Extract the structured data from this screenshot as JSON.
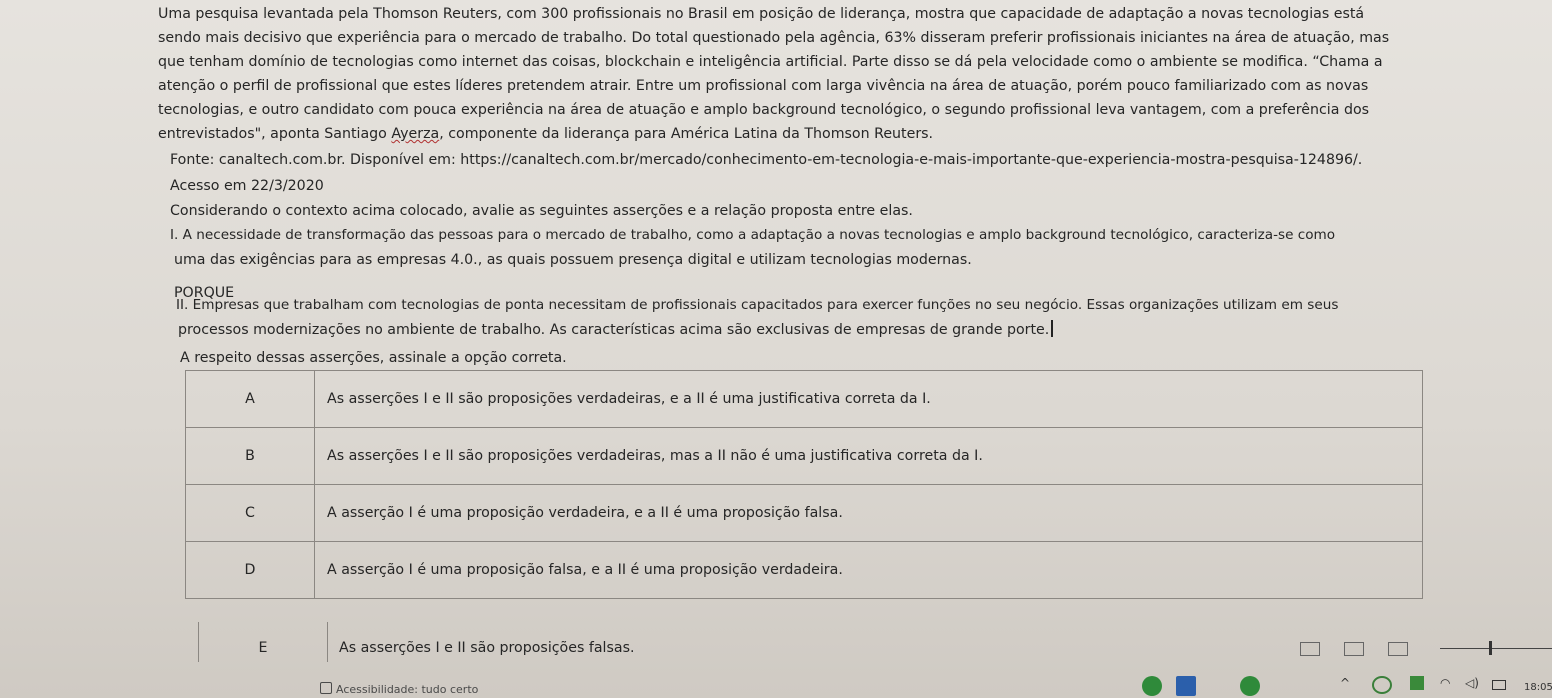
{
  "paragraph": {
    "lines": [
      "Uma pesquisa levantada pela Thomson Reuters, com 300 profissionais no Brasil em posição de liderança, mostra que capacidade de adaptação a novas tecnologias está",
      "sendo mais decisivo que experiência para o mercado de trabalho. Do total questionado pela agência, 63% disseram preferir profissionais iniciantes na área de atuação, mas",
      "que tenham domínio de tecnologias como internet das coisas, blockchain e inteligência artificial. Parte disso se dá pela velocidade como o ambiente se modifica. “Chama a",
      "atenção o perfil de profissional que estes líderes pretendem atrair. Entre um profissional com larga vivência na área de atuação, porém pouco familiarizado com as novas",
      "tecnologias, e outro candidato com pouca experiência na área de atuação e amplo background tecnológico, o segundo profissional leva vantagem, com a preferência dos"
    ],
    "line6_before": "entrevistados\", aponta Santiago ",
    "line6_name": "Ayerza",
    "line6_after": ", componente da liderança para América Latina da Thomson Reuters."
  },
  "source": {
    "line": "Fonte: canaltech.com.br. Disponível em: https://canaltech.com.br/mercado/conhecimento-em-tecnologia-e-mais-importante-que-experiencia-mostra-pesquisa-124896/.",
    "access": "Acesso em 22/3/2020"
  },
  "question": {
    "intro": "Considerando o contexto acima colocado, avalie as seguintes asserções e a relação proposta entre elas.",
    "assertion1_line1": "I. A necessidade de transformação das pessoas para o mercado de trabalho, como a adaptação a novas tecnologias e amplo background tecnológico, caracteriza-se como",
    "assertion1_line2": "uma das exigências para as empresas 4.0., as quais possuem presença digital e utilizam tecnologias modernas.",
    "connector": "PORQUE",
    "assertion2_line1": "II. Empresas que trabalham com tecnologias de ponta necessitam de profissionais capacitados para exercer funções no seu negócio. Essas organizações utilizam em seus",
    "assertion2_line2": "processos modernizações no ambiente de trabalho. As características acima são exclusivas de empresas de grande porte.",
    "prompt": "A respeito dessas asserções, assinale a opção correta."
  },
  "options": [
    {
      "letter": "A",
      "text": "As asserções I e II são proposições verdadeiras, e a II é uma justificativa correta da I."
    },
    {
      "letter": "B",
      "text": "As asserções I e II são proposições verdadeiras, mas a II não é uma justificativa correta da I."
    },
    {
      "letter": "C",
      "text": "A asserção I é uma proposição verdadeira, e a II é uma proposição falsa."
    },
    {
      "letter": "D",
      "text": "A asserção I é uma proposição falsa, e a II é uma proposição verdadeira."
    },
    {
      "letter": "E",
      "text": "As asserções I e II são proposições falsas."
    }
  ],
  "statusbar": {
    "accessibility": "Acessibilidade: tudo certo"
  },
  "tray": {
    "time": "18:05"
  },
  "icons": {
    "read-mode": "book-icon",
    "print-layout": "page-icon",
    "web-layout": "web-icon",
    "wifi": "wifi-icon",
    "volume": "speaker-icon",
    "battery": "battery-icon"
  }
}
